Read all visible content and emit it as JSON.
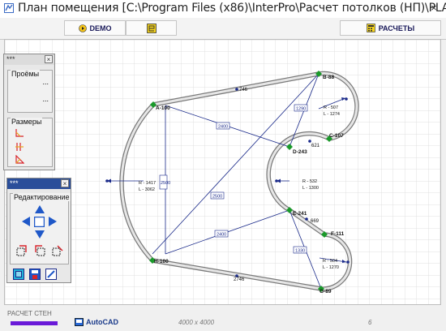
{
  "window": {
    "title": "План помещения [C:\\Program Files (x86)\\InterPro\\Расчет потолков (НП)\\PLA...",
    "close_label": "×"
  },
  "toolbar": {
    "demo_label": "DEMO",
    "calc_label": "РАСЧЕТЫ"
  },
  "panel_top": {
    "head": "***",
    "group_openings": {
      "title": "Проёмы",
      "item1": "...",
      "item2": "..."
    },
    "group_sizes": {
      "title": "Размеры"
    }
  },
  "panel_edit": {
    "head": "***",
    "title": "Редактирование"
  },
  "plan": {
    "vertices": {
      "a": "A-100",
      "b": "B-88",
      "c": "C-107",
      "d": "D-243",
      "e": "E-241",
      "f": "F-111",
      "g": "G-89",
      "h": "H-100"
    },
    "edge_labels": {
      "ab": "746",
      "cd": "621",
      "ef": "669",
      "gh": "2746",
      "ad": "2400",
      "ah": "2500",
      "bd": "1290",
      "he": "2400",
      "hd": "2500",
      "ge": "1330"
    },
    "arcs": {
      "left": {
        "r": "R - 1417",
        "l": "L - 3062"
      },
      "bc": {
        "r": "R - 507",
        "l": "L - 1274"
      },
      "de": {
        "r": "R - 532",
        "l": "L - 1300"
      },
      "fg": {
        "r": "R - 504",
        "l": "L - 1270"
      }
    }
  },
  "status": {
    "caption": "РАСЧЕТ СТЕН",
    "autocad_label": "AutoCAD",
    "dims": "4000 x 4000",
    "page": "6"
  },
  "colors": {
    "progress": "#6a1ad8",
    "vertex_marker": "#1a9a2a",
    "diagonal": "#1a2a8a",
    "panel_header": "#2a4e9a"
  }
}
